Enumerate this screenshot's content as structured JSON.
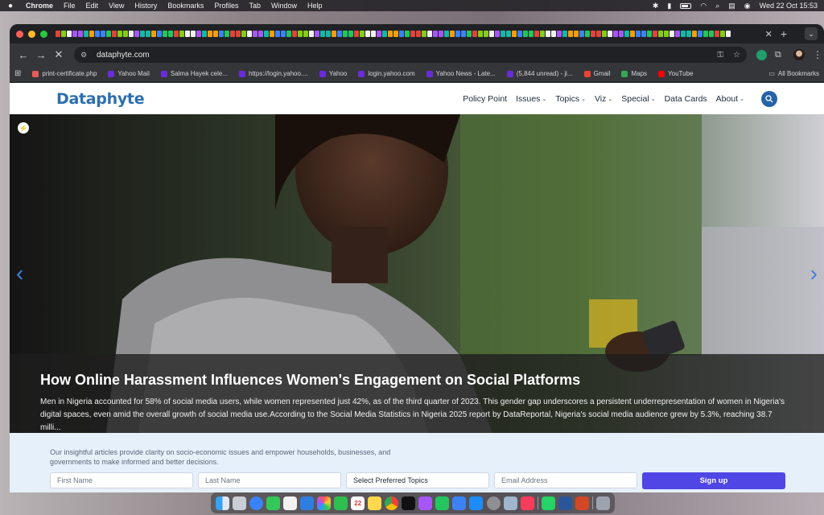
{
  "menubar": {
    "app_name": "Chrome",
    "items": [
      "File",
      "Edit",
      "View",
      "History",
      "Bookmarks",
      "Profiles",
      "Tab",
      "Window",
      "Help"
    ],
    "clock": "Wed 22 Oct  15:53"
  },
  "browser": {
    "url": "dataphyte.com",
    "bookmarks": [
      {
        "label": "print-certificate.php",
        "icon": "page-icon",
        "color": "#e45c5c"
      },
      {
        "label": "Yahoo Mail",
        "icon": "yahoo-icon",
        "color": "#6b2bd9"
      },
      {
        "label": "Salma Hayek cele...",
        "icon": "yahoo-icon",
        "color": "#6b2bd9"
      },
      {
        "label": "https://login.yahoo....",
        "icon": "yahoo-icon",
        "color": "#6b2bd9"
      },
      {
        "label": "Yahoo",
        "icon": "yahoo-icon",
        "color": "#6b2bd9"
      },
      {
        "label": "login.yahoo.com",
        "icon": "yahoo-icon",
        "color": "#6b2bd9"
      },
      {
        "label": "Yahoo News - Late...",
        "icon": "yahoo-icon",
        "color": "#6b2bd9"
      },
      {
        "label": "(5,844 unread) - ji...",
        "icon": "yahoo-icon",
        "color": "#6b2bd9"
      },
      {
        "label": "Gmail",
        "icon": "gmail-icon",
        "color": "#ea4335"
      },
      {
        "label": "Maps",
        "icon": "maps-icon",
        "color": "#34a853"
      },
      {
        "label": "YouTube",
        "icon": "youtube-icon",
        "color": "#ff0000"
      }
    ],
    "all_bookmarks": "All Bookmarks"
  },
  "site": {
    "logo": "Dataphyte",
    "nav": [
      {
        "label": "Policy Point",
        "dropdown": false
      },
      {
        "label": "Issues",
        "dropdown": true
      },
      {
        "label": "Topics",
        "dropdown": true
      },
      {
        "label": "Viz",
        "dropdown": true
      },
      {
        "label": "Special",
        "dropdown": true
      },
      {
        "label": "Data Cards",
        "dropdown": false
      },
      {
        "label": "About",
        "dropdown": true
      }
    ],
    "accent": "#2d6fae"
  },
  "hero": {
    "title": "How Online Harassment Influences Women's Engagement on Social Platforms",
    "excerpt": "Men in Nigeria accounted for 58% of social media users, while women represented just 42%, as of the third quarter of 2023. This gender gap underscores a persistent underrepresentation of women in Nigeria's digital spaces, even amid the overall growth of social media use.According to the Social Media Statistics in Nigeria 2025 report by DataReportal, Nigeria's social media audience grew by 5.3%, reaching 38.7 milli..."
  },
  "signup": {
    "text": "Our insightful articles provide clarity on socio-economic issues and empower households, businesses, and governments to make informed and better decisions.",
    "first_name_placeholder": "First Name",
    "last_name_placeholder": "Last Name",
    "topics_value": "Select Preferred Topics",
    "email_placeholder": "Email Address",
    "button_label": "Sign up",
    "button_color": "#4f46e5"
  },
  "dock": {
    "calendar_day": "22"
  }
}
